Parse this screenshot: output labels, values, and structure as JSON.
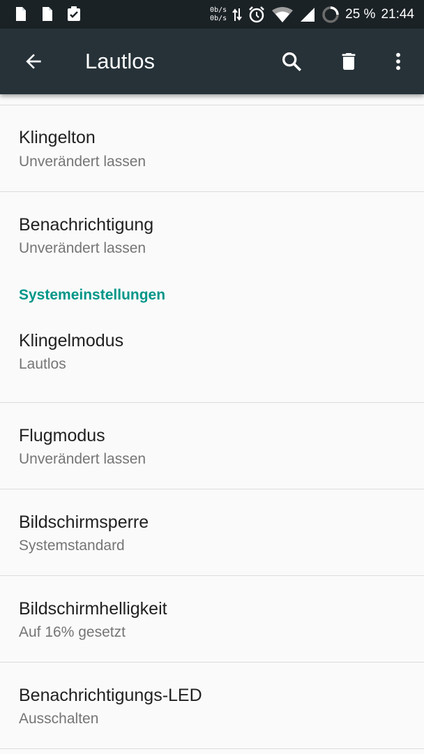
{
  "statusbar": {
    "left_icons": [
      "file-icon",
      "file-icon",
      "clipboard-check-icon"
    ],
    "net_up": "0b/s",
    "net_down": "0b/s",
    "battery_percent": "25 %",
    "time": "21:44"
  },
  "appbar": {
    "title": "Lautlos",
    "icons": [
      "back-arrow-icon",
      "search-icon",
      "delete-icon",
      "more-vert-icon"
    ]
  },
  "settings": {
    "items": [
      {
        "title": "Klingelton",
        "summary": "Unverändert lassen"
      },
      {
        "title": "Benachrichtigung",
        "summary": "Unverändert lassen"
      }
    ],
    "section_header": "Systemeinstellungen",
    "system_items": [
      {
        "title": "Klingelmodus",
        "summary": "Lautlos"
      },
      {
        "title": "Flugmodus",
        "summary": "Unverändert lassen"
      },
      {
        "title": "Bildschirmsperre",
        "summary": "Systemstandard"
      },
      {
        "title": "Bildschirmhelligkeit",
        "summary": "Auf 16% gesetzt"
      },
      {
        "title": "Benachrichtigungs-LED",
        "summary": "Ausschalten"
      }
    ]
  },
  "colors": {
    "appbar": "#263238",
    "statusbar": "#1b2226",
    "accent": "#009688",
    "background": "#fafafa"
  }
}
